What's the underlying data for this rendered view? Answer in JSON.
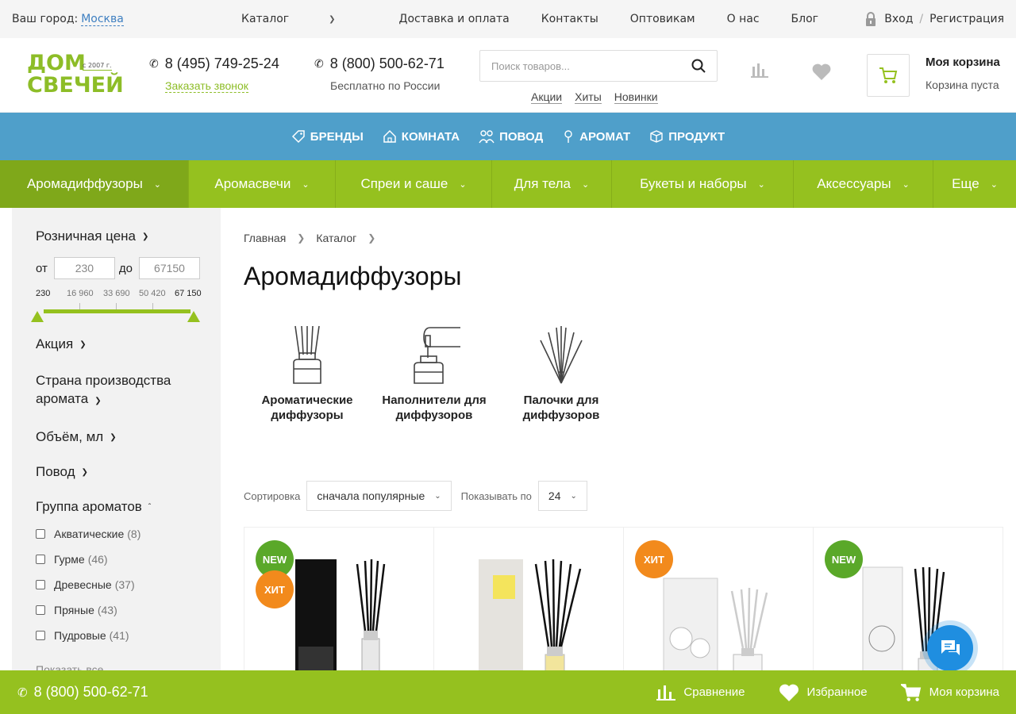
{
  "topbar": {
    "city_label": "Ваш город:",
    "city": "Москва",
    "nav": [
      "Каталог",
      "Доставка и оплата",
      "Контакты",
      "Оптовикам",
      "О нас",
      "Блог"
    ],
    "login": "Вход",
    "register": "Регистрация"
  },
  "header": {
    "logo_line1": "ДОМ",
    "logo_line2": "СВЕЧЕЙ",
    "logo_since": "с 2007 г.",
    "phone1": "8 (495) 749-25-24",
    "callback": "Заказать звонок",
    "phone2": "8 (800) 500-62-71",
    "free": "Бесплатно по России",
    "search_placeholder": "Поиск товаров...",
    "quicklinks": [
      "Акции",
      "Хиты",
      "Новинки"
    ],
    "cart_title": "Моя корзина",
    "cart_status": "Корзина пуста"
  },
  "bluebar": [
    "БРЕНДЫ",
    "КОМНАТА",
    "ПОВОД",
    "АРОМАТ",
    "ПРОДУКТ"
  ],
  "categories": [
    "Аромадиффузоры",
    "Аромасвечи",
    "Спреи и саше",
    "Для тела",
    "Букеты и наборы",
    "Аксессуары",
    "Еще"
  ],
  "sidebar": {
    "price_title": "Розничная цена",
    "from_label": "от",
    "to_label": "до",
    "price_from": "230",
    "price_to": "67150",
    "scale": [
      "230",
      "16 960",
      "33 690",
      "50 420",
      "67 150"
    ],
    "filters": [
      "Акция",
      "Страна производства аромата",
      "Объём, мл",
      "Повод",
      "Группа ароматов"
    ],
    "aroma_groups": [
      {
        "name": "Акватические",
        "count": "(8)"
      },
      {
        "name": "Гурме",
        "count": "(46)"
      },
      {
        "name": "Древесные",
        "count": "(37)"
      },
      {
        "name": "Пряные",
        "count": "(43)"
      },
      {
        "name": "Пудровые",
        "count": "(41)"
      }
    ],
    "show_all": "Показать все"
  },
  "main": {
    "breadcrumb": [
      "Главная",
      "Каталог"
    ],
    "title": "Аромадиффузоры",
    "subcategories": [
      "Ароматические диффузоры",
      "Наполнители для диффузоров",
      "Палочки для диффузоров"
    ],
    "sort_label": "Сортировка",
    "sort_value": "сначала популярные",
    "show_label": "Показывать по",
    "show_value": "24",
    "cards": [
      {
        "badges": [
          "NEW",
          "ХИТ"
        ]
      },
      {
        "badges": []
      },
      {
        "badges": [
          "ХИТ"
        ]
      },
      {
        "badges": [
          "NEW"
        ]
      }
    ]
  },
  "bottombar": {
    "phone": "8 (800) 500-62-71",
    "compare": "Сравнение",
    "favorites": "Избранное",
    "cart": "Моя корзина"
  },
  "colors": {
    "green": "#95c11f",
    "blue": "#4f9fca",
    "orange": "#f28a1c",
    "badge_green": "#5aa829"
  }
}
